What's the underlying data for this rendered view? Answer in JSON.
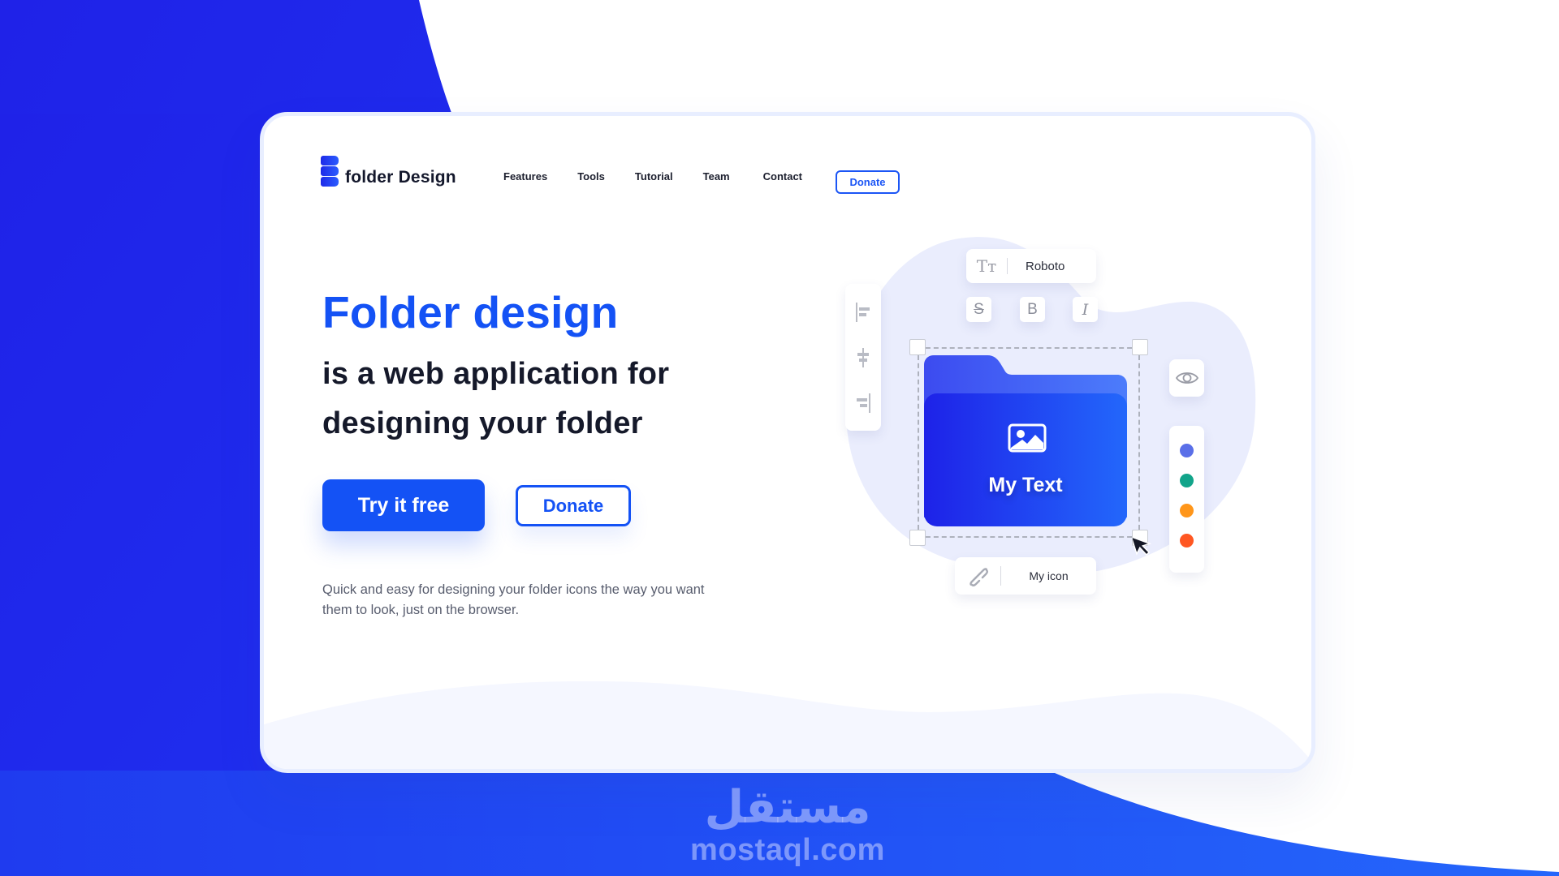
{
  "brand": {
    "name": "folder Design",
    "primary_color": "#1452f5",
    "background_blue": "#1f2ae8"
  },
  "nav": {
    "items": [
      "Features",
      "Tools",
      "Tutorial",
      "Team",
      "Contact"
    ],
    "donate_label": "Donate"
  },
  "hero": {
    "title": "Folder design",
    "subtitle_line1": "is a web application for",
    "subtitle_line2": "designing your folder",
    "primary_cta": "Try it free",
    "secondary_cta": "Donate",
    "description": "Quick and easy for designing your folder icons the way you want them to look, just on the browser."
  },
  "editor_mockup": {
    "font_icon": "text-size-icon",
    "font_name": "Roboto",
    "format_buttons": [
      {
        "icon": "strikethrough-icon",
        "glyph": "S"
      },
      {
        "icon": "bold-icon",
        "glyph": "B"
      },
      {
        "icon": "italic-icon",
        "glyph": "I"
      }
    ],
    "align_buttons": [
      "align-left-icon",
      "align-center-icon",
      "align-right-icon"
    ],
    "folder_label": "My Text",
    "folder_icon": "image-icon",
    "visibility_icon": "eye-icon",
    "color_swatches": [
      "#5a6fe8",
      "#12a48a",
      "#ff961a",
      "#ff5722"
    ],
    "link_icon": "link-icon",
    "icon_name": "My icon"
  },
  "watermark": {
    "arabic": "مستقل",
    "latin": "mostaql.com"
  }
}
